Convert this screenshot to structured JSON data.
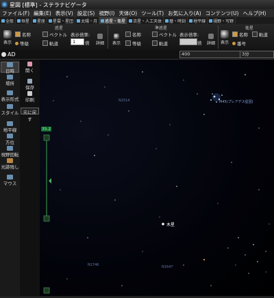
{
  "window": {
    "title": "星図 [標準] - ステラナビゲータ"
  },
  "menu": [
    {
      "label": "ファイル(F)"
    },
    {
      "label": "編集(E)"
    },
    {
      "label": "表示(V)"
    },
    {
      "label": "設定(S)"
    },
    {
      "label": "視野(I)"
    },
    {
      "label": "天体(O)"
    },
    {
      "label": "ツール(T)"
    },
    {
      "label": "お気に入り(A)"
    },
    {
      "label": "コンテンツ(U)"
    },
    {
      "label": "ヘルプ(H)"
    }
  ],
  "tabs": [
    {
      "label": "全般"
    },
    {
      "label": "恒星"
    },
    {
      "label": "星座"
    },
    {
      "label": "星雲・星団"
    },
    {
      "label": "太陽・月"
    },
    {
      "label": "惑星・衛星"
    },
    {
      "label": "流星・人工天体"
    },
    {
      "label": "暦・時刻"
    },
    {
      "label": "地平線"
    },
    {
      "label": "視野・写野"
    }
  ],
  "ribbon": {
    "planet_group": "惑星",
    "dwarf_group": "準惑星",
    "satellite_group": "衛星",
    "show": "表示",
    "name": "名称",
    "vector": "ベクトル",
    "orbit": "軌道",
    "mag": "等級",
    "scale_label": "表示倍率:",
    "scale_value": "1",
    "scale_unit": "倍",
    "detail": "詳細",
    "number": "番号"
  },
  "address": {
    "label": "AD",
    "search_value": "400",
    "time_value": "3分"
  },
  "left_panel": [
    {
      "label": "日時"
    },
    {
      "label": "場所"
    },
    {
      "label": "表示形式"
    },
    {
      "label": "スタイル"
    },
    {
      "label": "地平線"
    },
    {
      "label": "方位"
    },
    {
      "label": "視野回転"
    },
    {
      "label": "光跡残し"
    },
    {
      "label": "マウス"
    }
  ],
  "second_panel": [
    {
      "label": "開く"
    },
    {
      "label": "保存"
    },
    {
      "label": "印刷"
    },
    {
      "label": "元に戻す"
    }
  ],
  "zoom": {
    "readout": "35.2",
    "level_fraction": 0.45
  },
  "sky_labels": {
    "pleiades": "M45(プレアデス星団)",
    "n1514": "N1514",
    "jupiter": "木星",
    "n1746": "N1746",
    "n1647": "N1647"
  }
}
